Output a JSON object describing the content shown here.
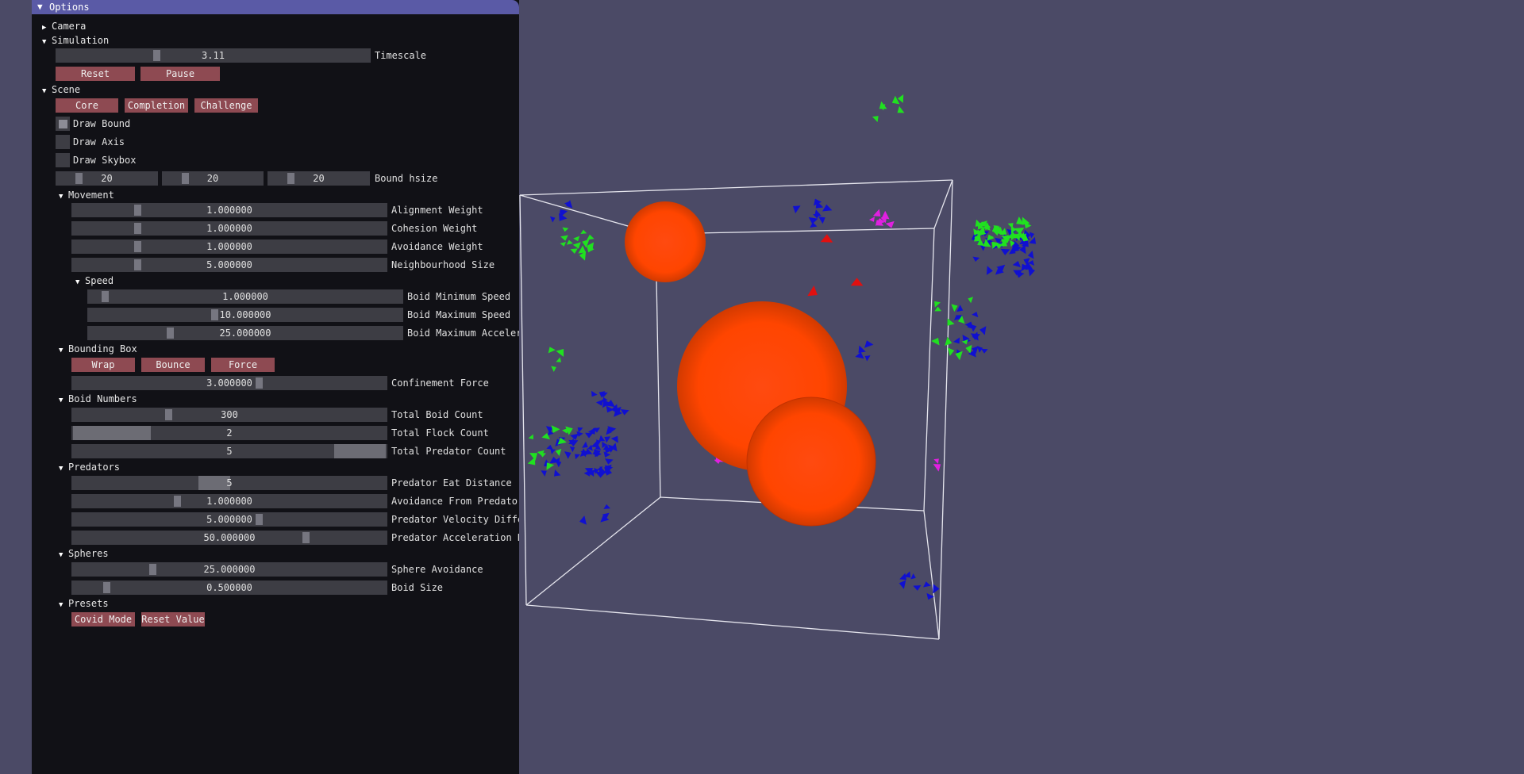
{
  "window": {
    "title": "Options"
  },
  "camera": {
    "label": "Camera"
  },
  "simulation": {
    "label": "Simulation",
    "timescale": {
      "value": "3.11",
      "label": "Timescale"
    },
    "reset_label": "Reset",
    "pause_label": "Pause"
  },
  "scene": {
    "label": "Scene",
    "buttons": {
      "core": "Core",
      "completion": "Completion",
      "challenge": "Challenge"
    },
    "draw_bound": {
      "label": "Draw Bound",
      "checked": true
    },
    "draw_axis": {
      "label": "Draw Axis",
      "checked": false
    },
    "draw_skybox": {
      "label": "Draw Skybox",
      "checked": false
    },
    "bound_hsize": {
      "x": "20",
      "y": "20",
      "z": "20",
      "label": "Bound hsize"
    }
  },
  "movement": {
    "label": "Movement",
    "alignment": {
      "value": "1.000000",
      "label": "Alignment Weight"
    },
    "cohesion": {
      "value": "1.000000",
      "label": "Cohesion Weight"
    },
    "avoidance": {
      "value": "1.000000",
      "label": "Avoidance Weight"
    },
    "neighbourhood": {
      "value": "5.000000",
      "label": "Neighbourhood Size"
    }
  },
  "speed": {
    "label": "Speed",
    "min": {
      "value": "1.000000",
      "label": "Boid Minimum Speed"
    },
    "max": {
      "value": "10.000000",
      "label": "Boid Maximum Speed"
    },
    "accel": {
      "value": "25.000000",
      "label": "Boid Maximum Acceler"
    }
  },
  "bounding_box": {
    "label": "Bounding Box",
    "wrap": "Wrap",
    "bounce": "Bounce",
    "force": "Force",
    "confinement": {
      "value": "3.000000",
      "label": "Confinement Force"
    }
  },
  "boid_numbers": {
    "label": "Boid Numbers",
    "total_boid": {
      "value": "300",
      "label": "Total Boid Count"
    },
    "total_flock": {
      "value": "2",
      "label": "Total Flock Count"
    },
    "total_predator": {
      "value": "5",
      "label": "Total Predator Count"
    }
  },
  "predators": {
    "label": "Predators",
    "eat_distance": {
      "value": "5",
      "label": "Predator Eat Distance"
    },
    "avoidance_from": {
      "value": "1.000000",
      "label": "Avoidance From Predator"
    },
    "velocity_diff": {
      "value": "5.000000",
      "label": "Predator Velocity Diffe"
    },
    "accel_diff": {
      "value": "50.000000",
      "label": "Predator Acceleration D"
    }
  },
  "spheres": {
    "label": "Spheres",
    "sphere_avoidance": {
      "value": "25.000000",
      "label": "Sphere Avoidance"
    },
    "boid_size": {
      "value": "0.500000",
      "label": "Boid Size"
    }
  },
  "presets": {
    "label": "Presets",
    "covid_mode": "Covid Mode",
    "reset_value": "Reset Value"
  },
  "colors": {
    "background": "#4b4a66",
    "panel": "#111116",
    "title_bar": "#5a5aa6",
    "button": "#8e4a52",
    "slider_track": "#3d3d44",
    "sphere": "#ff4500",
    "boid_flock_1": "#1010d0",
    "boid_flock_2": "#20e020",
    "boid_magenta": "#e020e0",
    "predator": "#e01010"
  }
}
